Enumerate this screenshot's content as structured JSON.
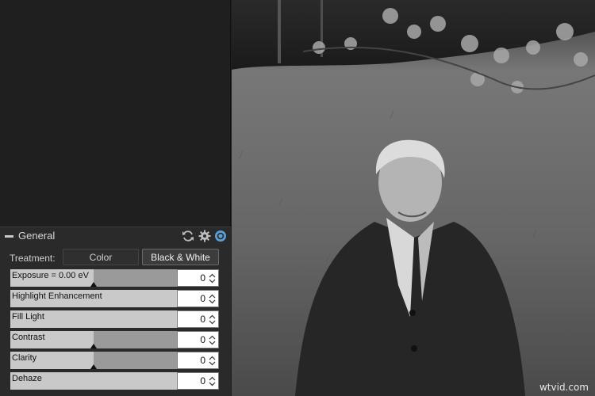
{
  "panel": {
    "title": "General",
    "icons": [
      "collapse-icon",
      "reset-icon",
      "gear-icon",
      "toggle-icon"
    ]
  },
  "treatment": {
    "label": "Treatment:",
    "options": [
      "Color",
      "Black & White"
    ],
    "selected": "Black & White"
  },
  "sliders": [
    {
      "label": "Exposure = 0.00 eV",
      "value": "0",
      "fill_fraction": 0.5,
      "centered": true
    },
    {
      "label": "Highlight Enhancement",
      "value": "0",
      "fill_fraction": 1.0,
      "centered": false
    },
    {
      "label": "Fill Light",
      "value": "0",
      "fill_fraction": 1.0,
      "centered": false
    },
    {
      "label": "Contrast",
      "value": "0",
      "fill_fraction": 0.5,
      "centered": true
    },
    {
      "label": "Clarity",
      "value": "0",
      "fill_fraction": 0.5,
      "centered": true
    },
    {
      "label": "Dehaze",
      "value": "0",
      "fill_fraction": 1.0,
      "centered": false
    }
  ],
  "photo": {
    "description_icon": "photo-preview",
    "watermark": "wtvid.com"
  },
  "colors": {
    "accent": "#5aa0d8",
    "panel_bg": "#2a2a2a"
  }
}
